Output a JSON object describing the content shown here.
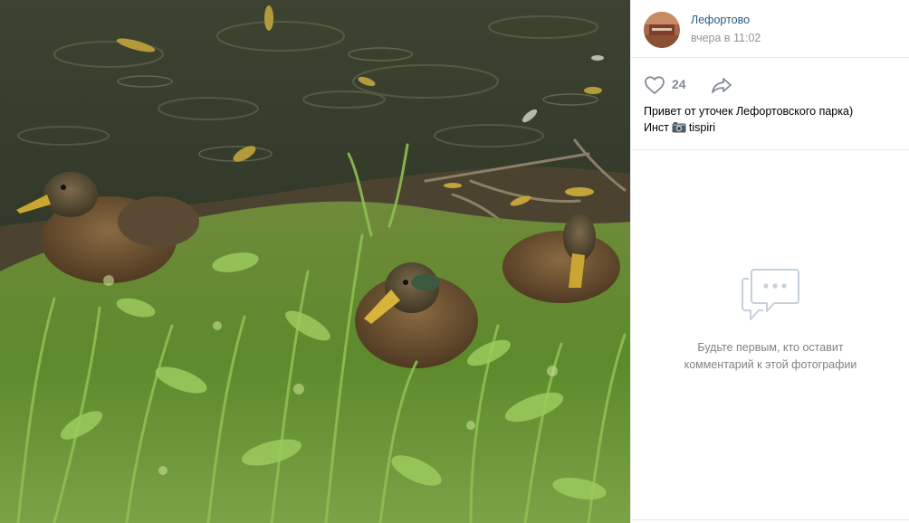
{
  "photo": {
    "subject": "ducks in grass by a pond"
  },
  "post": {
    "author_name": "Лефортово",
    "timestamp": "вчера в 11:02",
    "likes": "24",
    "caption_line1": "Привет от уточек Лефортовского парка)",
    "caption_line2_prefix": "Инст",
    "caption_line2_suffix": "tispiri"
  },
  "comments": {
    "empty_line1": "Будьте первым, кто оставит",
    "empty_line2": "комментарий к этой фотографии"
  },
  "icons": {
    "like": "heart-outline-icon",
    "share": "share-arrow-icon",
    "camera": "camera-emoji-icon",
    "comments_empty": "speech-bubble-icon"
  },
  "colors": {
    "link": "#2a5885",
    "muted": "#939393",
    "icon": "#828a99",
    "empty_icon": "#c5d0db",
    "divider": "#e7e8ec"
  }
}
